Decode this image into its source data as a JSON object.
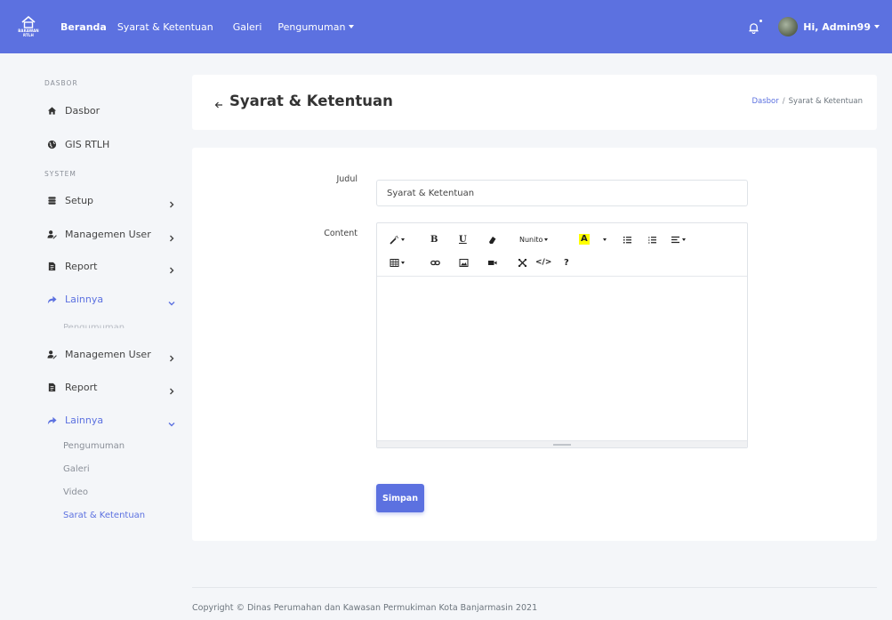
{
  "navbar": {
    "logo_text_line1": "BAKAWAN",
    "logo_text_line2": "RTLH",
    "links": [
      "Beranda",
      "Syarat & Ketentuan",
      "Galeri",
      "Pengumuman"
    ],
    "user_greeting": "Hi, Admin99",
    "brand_color": "#5c71e0"
  },
  "sidebar": {
    "section_dasbor": "DASBOR",
    "section_system": "SYSTEM",
    "items": {
      "dasbor": "Dasbor",
      "gis": "GIS RTLH",
      "setup": "Setup",
      "user1": "Managemen User",
      "report1": "Report",
      "lainnya1": "Lainnya",
      "pengumuman_faded": "Pengumuman",
      "user2": "Managemen User",
      "report2": "Report",
      "lainnya2": "Lainnya"
    },
    "subitems": [
      "Pengumuman",
      "Galeri",
      "Video",
      "Sarat & Ketentuan"
    ]
  },
  "header": {
    "title": "Syarat & Ketentuan",
    "breadcrumb_link": "Dasbor",
    "breadcrumb_sep": "/",
    "breadcrumb_current": "Syarat & Ketentuan"
  },
  "form": {
    "judul_label": "Judul",
    "judul_value": "Syarat & Ketentuan",
    "content_label": "Content",
    "editor": {
      "font_name": "Nunito",
      "highlight_letter": "A",
      "bold": "B",
      "underline": "U",
      "code": "</>",
      "help": "?"
    },
    "save_button": "Simpan"
  },
  "footer": {
    "copyright": "Copyright © Dinas Perumahan dan Kawasan Permukiman Kota Banjarmasin 2021"
  }
}
